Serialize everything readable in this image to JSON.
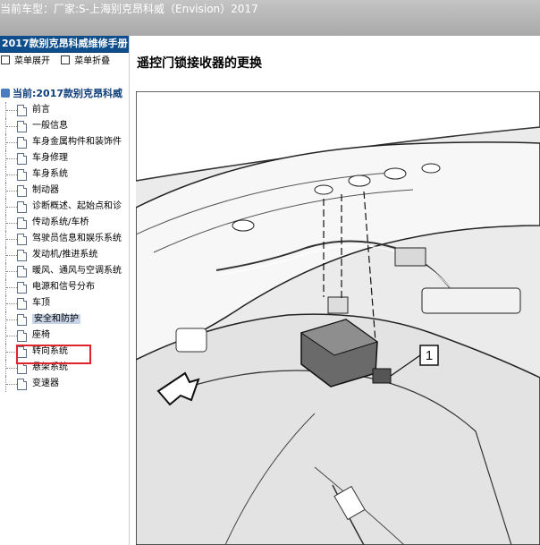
{
  "header": {
    "car_label": "当前车型：",
    "manufacturer": "厂家:S-上海别克昂科威（Envision）2017"
  },
  "sidebar": {
    "title": "2017款别克昂科威维修手册",
    "expand_label": "菜单展开",
    "collapse_label": "菜单折叠",
    "root_label": "当前:2017款别克昂科威",
    "items": [
      {
        "label": "前言"
      },
      {
        "label": "一般信息"
      },
      {
        "label": "车身金属构件和装饰件"
      },
      {
        "label": "车身修理"
      },
      {
        "label": "车身系统"
      },
      {
        "label": "制动器"
      },
      {
        "label": "诊断概述、起始点和诊"
      },
      {
        "label": "传动系统/车桥"
      },
      {
        "label": "驾驶员信息和娱乐系统"
      },
      {
        "label": "发动机/推进系统"
      },
      {
        "label": "暖风、通风与空调系统"
      },
      {
        "label": "电源和信号分布"
      },
      {
        "label": "车顶"
      },
      {
        "label": "安全和防护"
      },
      {
        "label": "座椅"
      },
      {
        "label": "转向系统"
      },
      {
        "label": "悬架系统"
      },
      {
        "label": "变速器"
      }
    ],
    "selected_index": 13
  },
  "content": {
    "title": "遥控门锁接收器的更换",
    "callout_number": "1"
  },
  "colors": {
    "sidebar_title_bg": "#0e4e8c",
    "highlight_border": "#e0242b",
    "header_bg": "#b5b5b5"
  }
}
